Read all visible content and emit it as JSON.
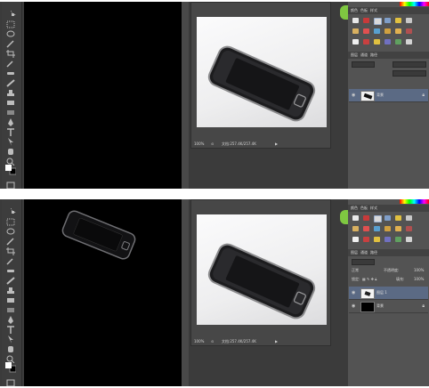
{
  "top": {
    "status_zoom": "100%",
    "status_doc": "文档:257.4K/257.4K",
    "panel_tabs": [
      "颜色",
      "色板",
      "样式"
    ],
    "layers_tabs": [
      "图层",
      "通道",
      "路径"
    ],
    "layers": [
      {
        "name": "背景",
        "active": true,
        "thumb": "phone"
      }
    ]
  },
  "bottom": {
    "status_zoom": "100%",
    "status_doc": "文档:257.4K/257.4K",
    "panel_tabs": [
      "颜色",
      "色板",
      "样式"
    ],
    "layers_tabs": [
      "图层",
      "通道",
      "路径"
    ],
    "blend_mode": "正常",
    "opacity_label": "不透明度:",
    "opacity_value": "100%",
    "lock_label": "锁定:",
    "fill_label": "填充:",
    "fill_value": "100%",
    "layers": [
      {
        "name": "图层 1",
        "active": true,
        "thumb": "white"
      },
      {
        "name": "背景",
        "active": false,
        "thumb": "black"
      }
    ]
  },
  "colors": {
    "ui_dark": "#3b3b3b",
    "canvas": "#000000",
    "panel": "#535353",
    "layer_active": "#5b6a84",
    "leaf": "#7fc841"
  }
}
